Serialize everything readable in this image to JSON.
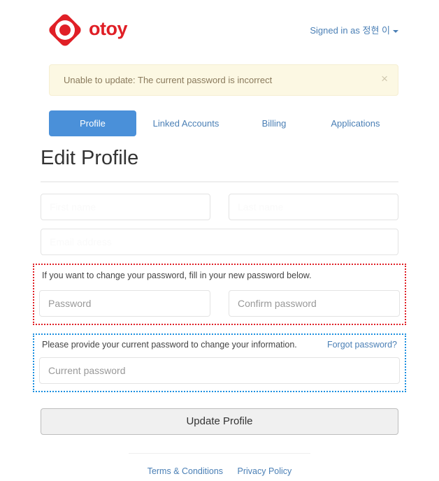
{
  "header": {
    "logo_name": "otoy-logo-icon",
    "wordmark": "otoy",
    "logo_color": "#e01f26",
    "signed_in_text": "Signed in as 정현 이",
    "caret_name": "chevron-down-icon"
  },
  "alert": {
    "message": "Unable to update: The current password is incorrect",
    "close_label": "×",
    "background": "#fcf8e3",
    "text_color": "#8a7a5c"
  },
  "tabs": [
    {
      "label": "Profile",
      "active": true
    },
    {
      "label": "Linked Accounts",
      "active": false
    },
    {
      "label": "Billing",
      "active": false
    },
    {
      "label": "Applications",
      "active": false
    }
  ],
  "page": {
    "title": "Edit Profile"
  },
  "form": {
    "first_name": {
      "placeholder": "First name",
      "value": ""
    },
    "last_name": {
      "placeholder": "Last name",
      "value": ""
    },
    "email": {
      "placeholder": "Email address",
      "value": ""
    },
    "new_password_note": "If you want to change your password, fill in your new password below.",
    "password": {
      "placeholder": "Password",
      "value": ""
    },
    "confirm_password": {
      "placeholder": "Confirm password",
      "value": ""
    },
    "current_password_note": "Please provide your current password to change your information.",
    "forgot_password_link": "Forgot password?",
    "current_password": {
      "placeholder": "Current password",
      "value": ""
    },
    "submit_label": "Update Profile"
  },
  "annotations": {
    "red_box_color": "#e01f26",
    "blue_box_color": "#1a8fe0"
  },
  "footer": {
    "links": [
      {
        "label": "Terms & Conditions"
      },
      {
        "label": "Privacy Policy"
      }
    ]
  },
  "colors": {
    "primary_blue": "#4a90d9",
    "link_blue": "#4a7fb5",
    "brand_red": "#e01f26"
  }
}
